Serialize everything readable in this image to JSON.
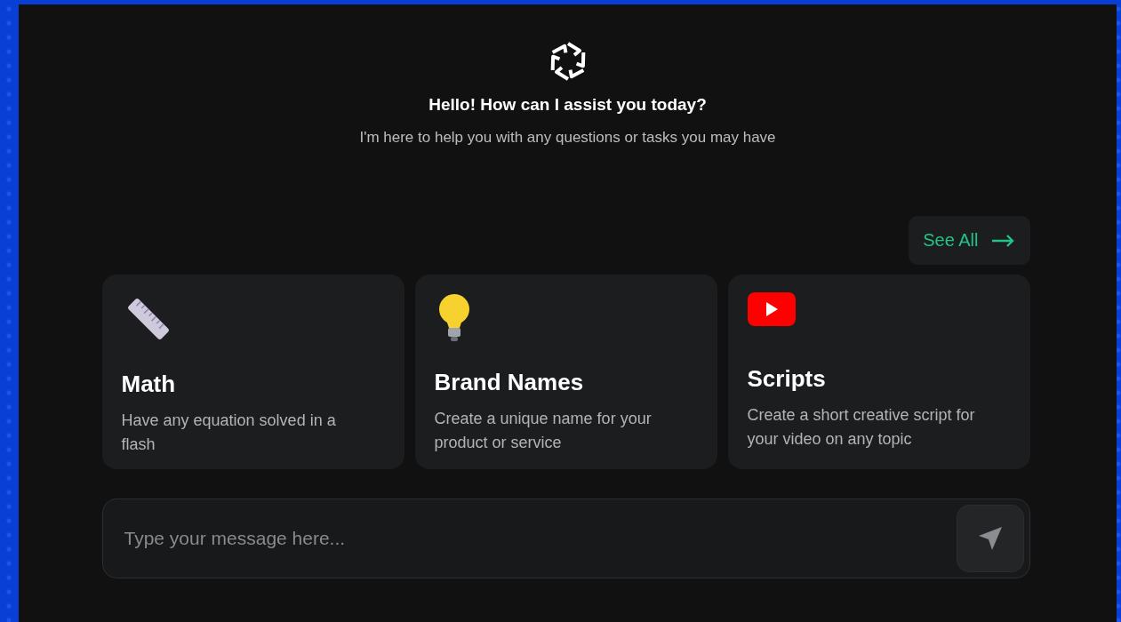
{
  "greeting": {
    "title": "Hello! How can I assist you today?",
    "subtitle": "I'm here to help you with any questions or tasks you may have"
  },
  "see_all": {
    "label": "See All"
  },
  "cards": [
    {
      "kind": "ruler",
      "title": "Math",
      "description": "Have any equation solved in a flash"
    },
    {
      "kind": "bulb",
      "title": "Brand Names",
      "description": "Create a unique name for your product or service"
    },
    {
      "kind": "video",
      "title": "Scripts",
      "description": "Create a short creative script for your video on any topic"
    }
  ],
  "composer": {
    "placeholder": "Type your message here..."
  }
}
